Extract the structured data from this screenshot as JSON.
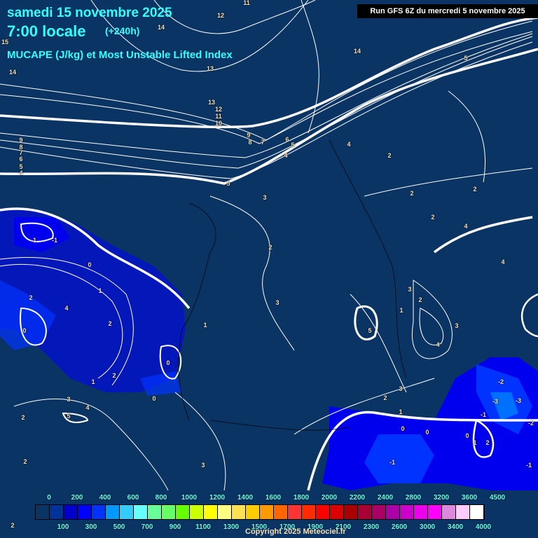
{
  "header": {
    "date": "samedi 15 novembre 2025",
    "time": "7:00 locale",
    "lead": "(+240h)",
    "product": "MUCAPE (J/kg) et Most Unstable Lifted Index",
    "run": "Run GFS 6Z du mercredi 5 novembre 2025"
  },
  "contour_labels": [
    "11",
    "12",
    "14",
    "15",
    "14",
    "13",
    "14",
    "13",
    "12",
    "11",
    "10",
    "9",
    "8",
    "7",
    "6",
    "5",
    "4",
    "9",
    "8",
    "7",
    "6",
    "5",
    "4",
    "5",
    "3",
    "2",
    "4",
    "2",
    "2",
    "5",
    "4",
    "4",
    "2",
    "-1",
    "-1",
    "0",
    "1",
    "2",
    "4",
    "0",
    "2",
    "1",
    "2",
    "0",
    "1",
    "3",
    "4",
    "5",
    "2",
    "0",
    "2",
    "3",
    "1",
    "2",
    "3",
    "5",
    "4",
    "3",
    "3",
    "2",
    "1",
    "0",
    "0",
    "-2",
    "-3",
    "-3",
    "-2",
    "-1",
    "2",
    "1",
    "-1",
    "-1",
    "0",
    "2",
    "2",
    "3"
  ],
  "colorbar": {
    "colors": [
      "#0b1740",
      "#0a3463",
      "#003399",
      "#0000cc",
      "#0000ff",
      "#0033ff",
      "#0099ff",
      "#33ccff",
      "#66ffff",
      "#66ff99",
      "#66ff66",
      "#66ff00",
      "#ccff00",
      "#ffff00",
      "#ffff80",
      "#ffe050",
      "#ffcc00",
      "#ff9900",
      "#ff6600",
      "#ff3333",
      "#ff2a00",
      "#ff0000",
      "#dd0000",
      "#aa0000",
      "#aa0033",
      "#aa0066",
      "#aa00aa",
      "#cc00cc",
      "#ee00ee",
      "#ff00ff",
      "#dd88dd",
      "#ffccff",
      "#ffffff"
    ],
    "labels_top": [
      "0",
      "200",
      "400",
      "600",
      "800",
      "1000",
      "1200",
      "1400",
      "1600",
      "1800",
      "2000",
      "2200",
      "2400",
      "2800",
      "3200",
      "3600",
      "4500"
    ],
    "labels_bottom": [
      "100",
      "300",
      "500",
      "700",
      "900",
      "1100",
      "1300",
      "1500",
      "1700",
      "1900",
      "2100",
      "2300",
      "2600",
      "3000",
      "3400",
      "4000"
    ]
  },
  "copyright": "Copyright 2025 Meteociel.fr"
}
